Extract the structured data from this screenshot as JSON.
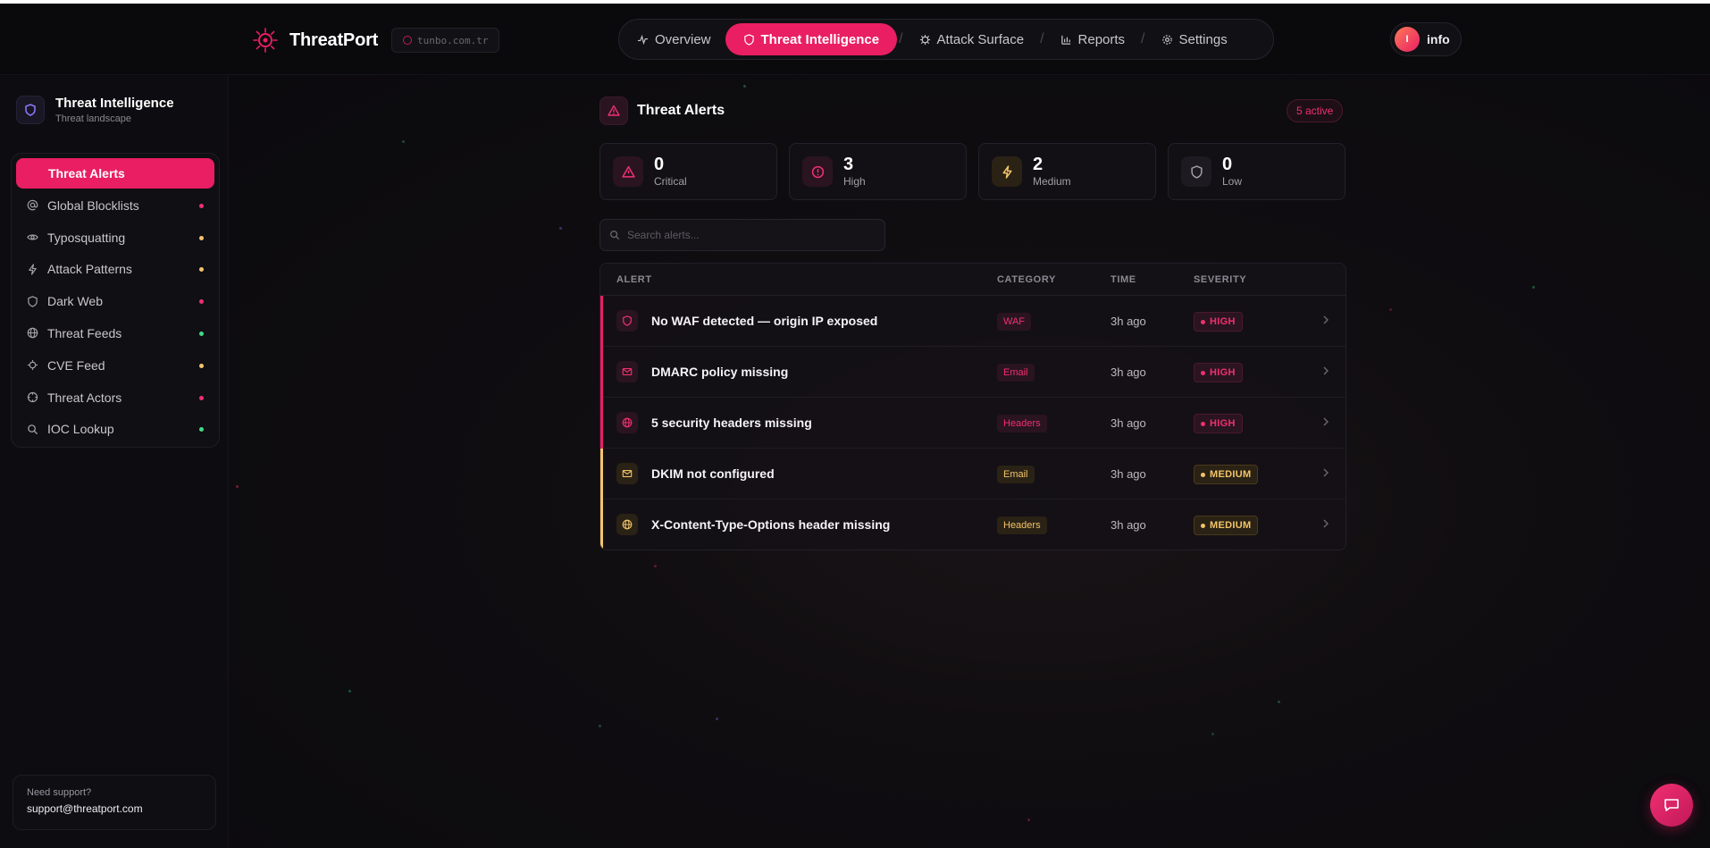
{
  "header": {
    "brand": "ThreatPort",
    "domain": "tunbo.com.tr",
    "nav": [
      {
        "label": "Overview",
        "icon": "activity-icon"
      },
      {
        "label": "Threat Intelligence",
        "icon": "shield-icon",
        "active": true
      },
      {
        "label": "Attack Surface",
        "icon": "bug-icon"
      },
      {
        "label": "Reports",
        "icon": "bar-chart-icon"
      },
      {
        "label": "Settings",
        "icon": "gear-icon"
      }
    ],
    "user": {
      "initial": "I",
      "name": "info"
    }
  },
  "sidebar": {
    "title": "Threat Intelligence",
    "subtitle": "Threat landscape",
    "items": [
      {
        "label": "Threat Alerts",
        "active": true
      },
      {
        "label": "Global Blocklists",
        "icon": "at-icon",
        "dot": "#f0306f"
      },
      {
        "label": "Typosquatting",
        "icon": "eye-icon",
        "dot": "#f2c46b"
      },
      {
        "label": "Attack Patterns",
        "icon": "bolt-icon",
        "dot": "#f2c46b"
      },
      {
        "label": "Dark Web",
        "icon": "shield-icon",
        "dot": "#f0306f"
      },
      {
        "label": "Threat Feeds",
        "icon": "globe-icon",
        "dot": "#3ddc84"
      },
      {
        "label": "CVE Feed",
        "icon": "bug-icon",
        "dot": "#f2c46b"
      },
      {
        "label": "Threat Actors",
        "icon": "crosshair-icon",
        "dot": "#f0306f"
      },
      {
        "label": "IOC Lookup",
        "icon": "search-icon",
        "dot": "#3ddc84"
      }
    ],
    "support": {
      "label": "Need support?",
      "email": "support@threatport.com"
    }
  },
  "main": {
    "title": "Threat Alerts",
    "active_badge": "5 active",
    "stats": [
      {
        "value": "0",
        "label": "Critical",
        "icon": "warning-icon",
        "color": "#f0306f"
      },
      {
        "value": "3",
        "label": "High",
        "icon": "alert-circle-icon",
        "color": "#f0306f"
      },
      {
        "value": "2",
        "label": "Medium",
        "icon": "bolt-icon",
        "color": "#f2c46b"
      },
      {
        "value": "0",
        "label": "Low",
        "icon": "shield-icon",
        "color": "#a39fa8"
      }
    ],
    "search_placeholder": "Search alerts...",
    "table": {
      "headers": [
        "ALERT",
        "CATEGORY",
        "TIME",
        "SEVERITY"
      ],
      "rows": [
        {
          "title": "No WAF detected — origin IP exposed",
          "icon": "shield-icon",
          "category": "WAF",
          "time": "3h ago",
          "severity": "HIGH"
        },
        {
          "title": "DMARC policy missing",
          "icon": "mail-icon",
          "category": "Email",
          "time": "3h ago",
          "severity": "HIGH"
        },
        {
          "title": "5 security headers missing",
          "icon": "globe-icon",
          "category": "Headers",
          "time": "3h ago",
          "severity": "HIGH"
        },
        {
          "title": "DKIM not configured",
          "icon": "mail-icon",
          "category": "Email",
          "time": "3h ago",
          "severity": "MEDIUM"
        },
        {
          "title": "X-Content-Type-Options header missing",
          "icon": "globe-icon",
          "category": "Headers",
          "time": "3h ago",
          "severity": "MEDIUM"
        }
      ]
    }
  },
  "colors": {
    "accent": "#e91e63",
    "high": "#f0306f",
    "medium": "#f2c46b",
    "ok": "#3ddc84"
  }
}
